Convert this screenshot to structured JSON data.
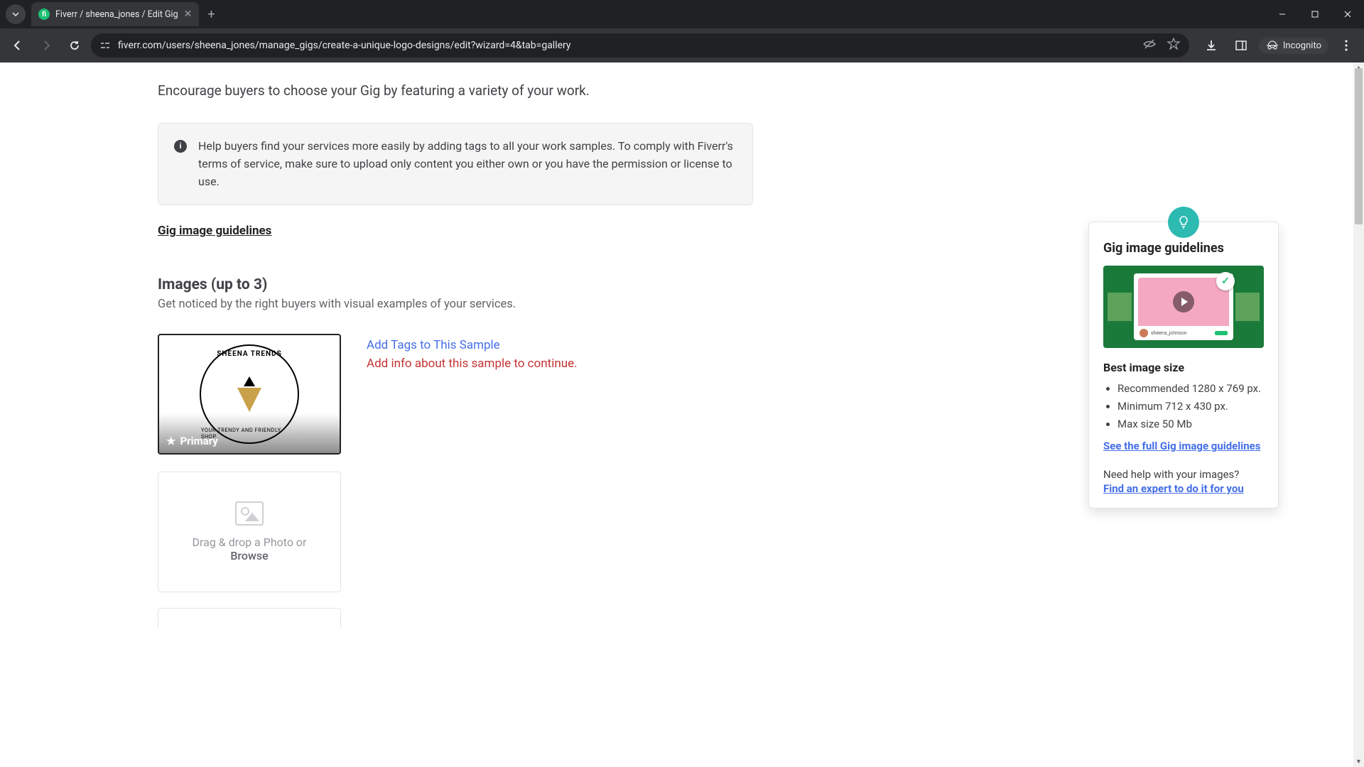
{
  "browser": {
    "tab_title": "Fiverr / sheena_jones / Edit Gig",
    "url": "fiverr.com/users/sheena_jones/manage_gigs/create-a-unique-logo-designs/edit?wizard=4&tab=gallery",
    "incognito_label": "Incognito"
  },
  "page": {
    "subtitle": "Encourage buyers to choose your Gig by featuring a variety of your work.",
    "info_text": "Help buyers find your services more easily by adding tags to all your work samples. To comply with Fiverr's terms of service, make sure to upload only content you either own or you have the permission or license to use.",
    "guidelines_link": "Gig image guidelines",
    "images_heading": "Images (up to 3)",
    "images_sub": "Get noticed by the right buyers with visual examples of your services.",
    "primary_badge": "Primary",
    "logo_top": "SHEENA TRENDS",
    "logo_bottom": "YOUR TRENDY AND FRIENDLY SHOP",
    "add_tags": "Add Tags to This Sample",
    "add_info_error": "Add info about this sample to continue.",
    "dropzone_text": "Drag & drop a Photo or",
    "browse": "Browse"
  },
  "tip": {
    "heading": "Gig image guidelines",
    "preview_user": "sheena_johnson",
    "best_size_h": "Best image size",
    "bullets": [
      "Recommended 1280 x 769 px.",
      "Minimum 712 x 430 px.",
      "Max size 50 Mb"
    ],
    "full_link": "See the full Gig image guidelines",
    "help_q": "Need help with your images?",
    "expert_link": "Find an expert to do it for you"
  }
}
